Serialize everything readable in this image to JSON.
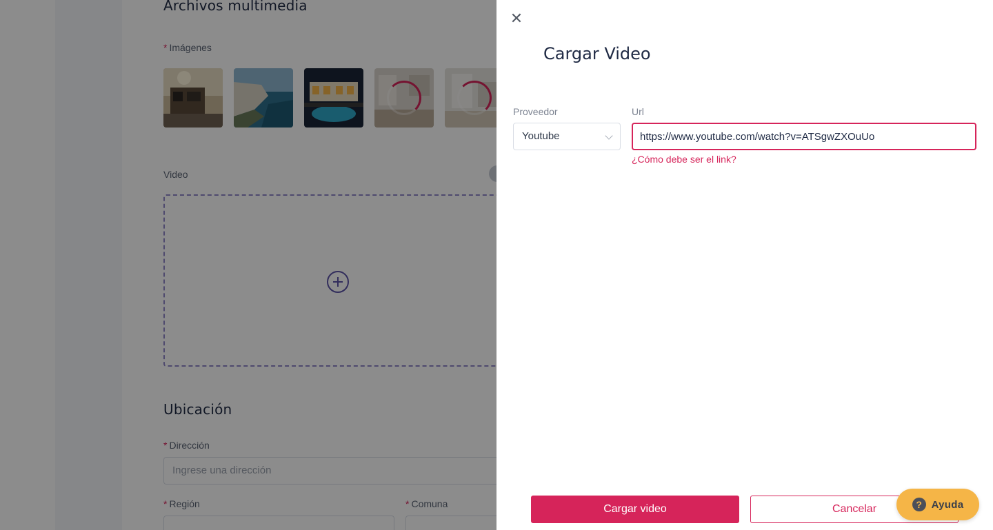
{
  "background": {
    "media_title": "Archivos multimedia",
    "images_label": "Imágenes",
    "video_label": "Video",
    "location_title": "Ubicación",
    "address_label": "Dirección",
    "address_placeholder": "Ingrese una dirección",
    "region_label": "Región",
    "commune_label": "Comuna",
    "required_marker": "*"
  },
  "drawer": {
    "close_icon": "close-icon",
    "title": "Cargar Video",
    "provider_label": "Proveedor",
    "provider_value": "Youtube",
    "url_label": "Url",
    "url_value": "https://www.youtube.com/watch?v=ATSgwZXOuUo",
    "help_link": "¿Cómo debe ser el link?",
    "submit_label": "Cargar video",
    "cancel_label": "Cancelar"
  },
  "help_widget": {
    "label": "Ayuda",
    "icon": "question-icon",
    "glyph": "?"
  },
  "colors": {
    "accent": "#d6245a",
    "help": "#f5b547",
    "title": "#1f2a44"
  }
}
